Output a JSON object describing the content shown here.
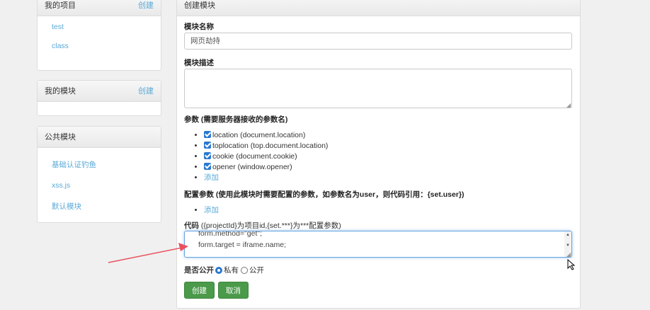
{
  "sidebar": {
    "my_projects": {
      "title": "我的项目",
      "action": "创建",
      "items": [
        "test",
        "class"
      ]
    },
    "my_modules": {
      "title": "我的模块",
      "action": "创建"
    },
    "public_modules": {
      "title": "公共模块",
      "items": [
        "基础认证钓鱼",
        "xss.js",
        "默认模块"
      ]
    }
  },
  "form": {
    "panel_title": "创建模块",
    "name_label": "模块名称",
    "name_value": "网页劫持",
    "desc_label": "模块描述",
    "desc_value": "",
    "params_label": "参数 (需要服务器接收的参数名)",
    "params": [
      {
        "label": "location (document.location)",
        "checked": true
      },
      {
        "label": "toplocation (top.document.location)",
        "checked": true
      },
      {
        "label": "cookie (document.cookie)",
        "checked": true
      },
      {
        "label": "opener (window.opener)",
        "checked": true
      }
    ],
    "add_label": "添加",
    "config_label": "配置参数 (使用此模块时需要配置的参数，如参数名为user，则代码引用：{set.user})",
    "config_add_label": "添加",
    "code_label_bold": "代码",
    "code_label_rest": "({projectId}为项目id,{set.***}为***配置参数)",
    "code_lines": [
      "form.method=\"get\";",
      "form.target = iframe.name;"
    ],
    "public_label": "是否公开",
    "private_option": "私有",
    "public_option": "公开",
    "create_button": "创建",
    "cancel_button": "取消"
  }
}
